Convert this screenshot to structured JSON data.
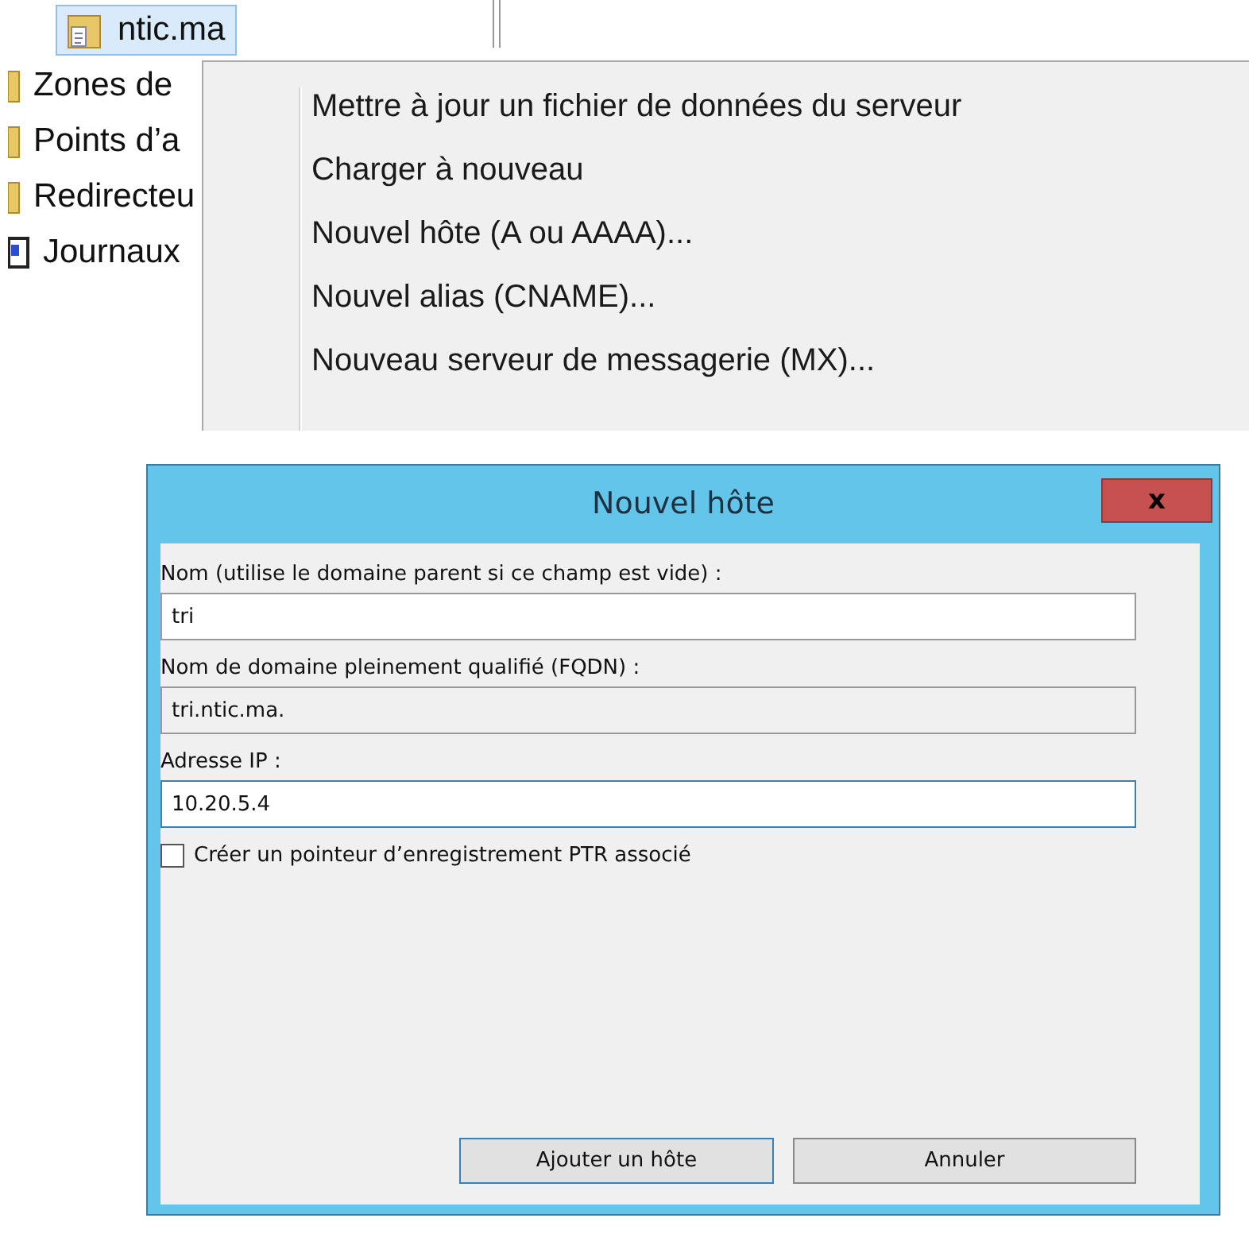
{
  "tree": {
    "items": [
      {
        "label": "ntic.ma",
        "kind": "zone",
        "selected": true
      },
      {
        "label": "Zones de",
        "kind": "folder",
        "selected": false
      },
      {
        "label": "Points d’a",
        "kind": "folder",
        "selected": false
      },
      {
        "label": "Redirecteu",
        "kind": "folder",
        "selected": false
      },
      {
        "label": "Journaux",
        "kind": "log",
        "selected": false
      }
    ]
  },
  "context_menu": {
    "items": [
      "Mettre à jour un fichier de données du serveur",
      "Charger à nouveau",
      "Nouvel hôte (A ou AAAA)...",
      "Nouvel alias (CNAME)...",
      "Nouveau serveur de messagerie (MX)..."
    ]
  },
  "dialog": {
    "title": "Nouvel hôte",
    "close": "x",
    "fields": [
      {
        "label": "Nom (utilise le domaine parent si ce champ est vide) :",
        "value": "tri",
        "disabled": false,
        "focused": false
      },
      {
        "label": "Nom de domaine pleinement qualifié (FQDN) :",
        "value": "tri.ntic.ma.",
        "disabled": true,
        "focused": false
      },
      {
        "label": "Adresse IP :",
        "value": "10.20.5.4",
        "disabled": false,
        "focused": true
      }
    ],
    "checkbox": {
      "label": "Créer un pointeur d’enregistrement PTR associé",
      "checked": false
    },
    "buttons": [
      {
        "label": "Ajouter un hôte",
        "default": true
      },
      {
        "label": "Annuler",
        "default": false
      }
    ]
  }
}
